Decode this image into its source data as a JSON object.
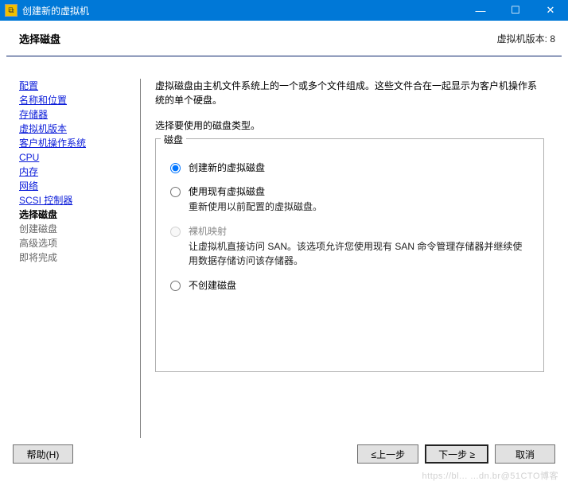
{
  "window": {
    "title": "创建新的虚拟机",
    "controls": {
      "minimize": "—",
      "maximize": "☐",
      "close": "✕"
    }
  },
  "header": {
    "title": "选择磁盘",
    "version_label": "虚拟机版本: 8"
  },
  "sidebar": {
    "items": [
      {
        "label": "配置",
        "state": "link"
      },
      {
        "label": "名称和位置",
        "state": "link"
      },
      {
        "label": "存储器",
        "state": "link"
      },
      {
        "label": "虚拟机版本",
        "state": "link"
      },
      {
        "label": "客户机操作系统",
        "state": "link"
      },
      {
        "label": "CPU",
        "state": "link"
      },
      {
        "label": "内存",
        "state": "link"
      },
      {
        "label": "网络",
        "state": "link"
      },
      {
        "label": "SCSI 控制器",
        "state": "link"
      },
      {
        "label": "选择磁盘",
        "state": "active"
      },
      {
        "label": "创建磁盘",
        "state": "disabled"
      },
      {
        "label": "高级选项",
        "state": "disabled"
      },
      {
        "label": "即将完成",
        "state": "disabled"
      }
    ]
  },
  "main": {
    "description": "虚拟磁盘由主机文件系统上的一个或多个文件组成。这些文件合在一起显示为客户机操作系统的单个硬盘。",
    "subtext": "选择要使用的磁盘类型。",
    "groupbox_label": "磁盘",
    "options": [
      {
        "label": "创建新的虚拟磁盘",
        "desc": "",
        "selected": true,
        "enabled": true
      },
      {
        "label": "使用现有虚拟磁盘",
        "desc": "重新使用以前配置的虚拟磁盘。",
        "selected": false,
        "enabled": true
      },
      {
        "label": "裸机映射",
        "desc": "让虚拟机直接访问 SAN。该选项允许您使用现有 SAN 命令管理存储器并继续使用数据存储访问该存储器。",
        "selected": false,
        "enabled": false
      },
      {
        "label": "不创建磁盘",
        "desc": "",
        "selected": false,
        "enabled": true
      }
    ]
  },
  "footer": {
    "help": "帮助(H)",
    "back": "≤上一步",
    "next": "下一步 ≥",
    "cancel": "取消"
  },
  "watermark": "https://bl... ...dn.br@51CTO博客"
}
